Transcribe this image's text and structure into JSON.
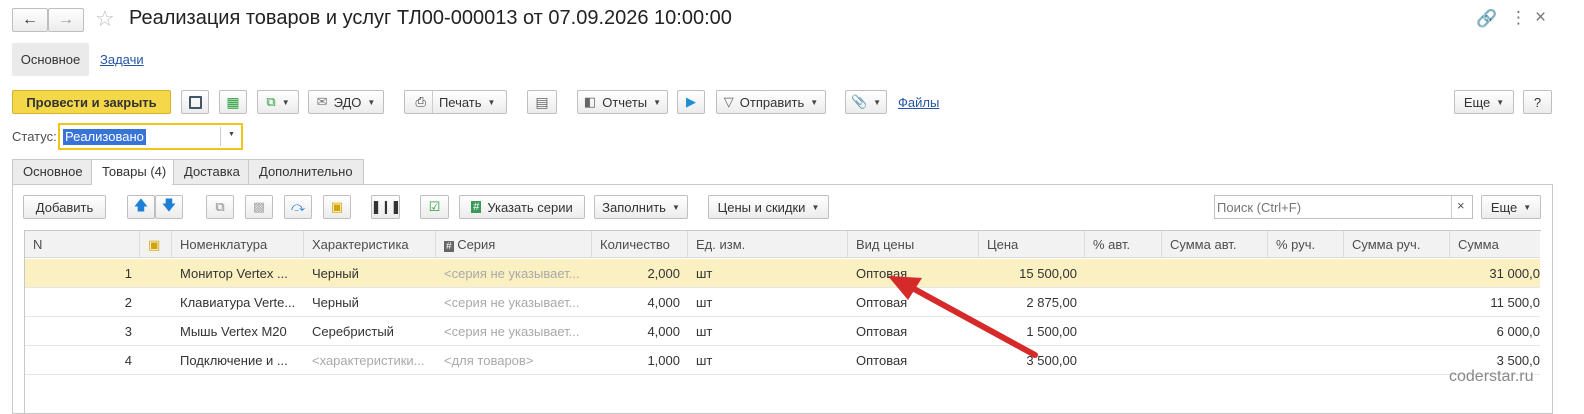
{
  "window": {
    "title": "Реализация товаров и услуг ТЛ00-000013 от 07.09.2026 10:00:00"
  },
  "nav_tabs": {
    "main": "Основное",
    "tasks": "Задачи"
  },
  "toolbar": {
    "post_close": "Провести и закрыть",
    "edo": "ЭДО",
    "print": "Печать",
    "reports": "Отчеты",
    "send": "Отправить",
    "files": "Файлы",
    "more": "Еще",
    "help": "?"
  },
  "status": {
    "label": "Статус:",
    "value": "Реализовано"
  },
  "doc_tabs": [
    "Основное",
    "Товары (4)",
    "Доставка",
    "Дополнительно"
  ],
  "table_toolbar": {
    "add": "Добавить",
    "specify_series": "Указать серии",
    "fill": "Заполнить",
    "prices": "Цены и скидки",
    "search_placeholder": "Поиск (Ctrl+F)",
    "clear": "×",
    "more": "Еще"
  },
  "columns": [
    "N",
    "Номенклатура",
    "Характеристика",
    "Серия",
    "Количество",
    "Ед. изм.",
    "Вид цены",
    "Цена",
    "% авт.",
    "Сумма авт.",
    "% руч.",
    "Сумма руч.",
    "Сумма"
  ],
  "rows": [
    {
      "n": "1",
      "nom": "Монитор Vertex ...",
      "char": "Черный",
      "series": "<серия не указывает...",
      "qty": "2,000",
      "unit": "шт",
      "price_type": "Оптовая",
      "price": "15 500,00",
      "sum": "31 000,0"
    },
    {
      "n": "2",
      "nom": "Клавиатура Verte...",
      "char": "Черный",
      "series": "<серия не указывает...",
      "qty": "4,000",
      "unit": "шт",
      "price_type": "Оптовая",
      "price": "2 875,00",
      "sum": "11 500,0"
    },
    {
      "n": "3",
      "nom": "Мышь Vertex M20",
      "char": "Серебристый",
      "series": "<серия не указывает...",
      "qty": "4,000",
      "unit": "шт",
      "price_type": "Оптовая",
      "price": "1 500,00",
      "sum": "6 000,0"
    },
    {
      "n": "4",
      "nom": "Подключение и ...",
      "char": "<характеристики...",
      "series": "<для товаров>",
      "qty": "1,000",
      "unit": "шт",
      "price_type": "Оптовая",
      "price": "3 500,00",
      "sum": "3 500,0"
    }
  ],
  "watermark": "coderstar.ru",
  "colors": {
    "accent_yellow": "#f5d84a",
    "selected_row": "#fbf0c2",
    "arrow_red": "#d62a2a",
    "link_blue": "#2554a6"
  }
}
